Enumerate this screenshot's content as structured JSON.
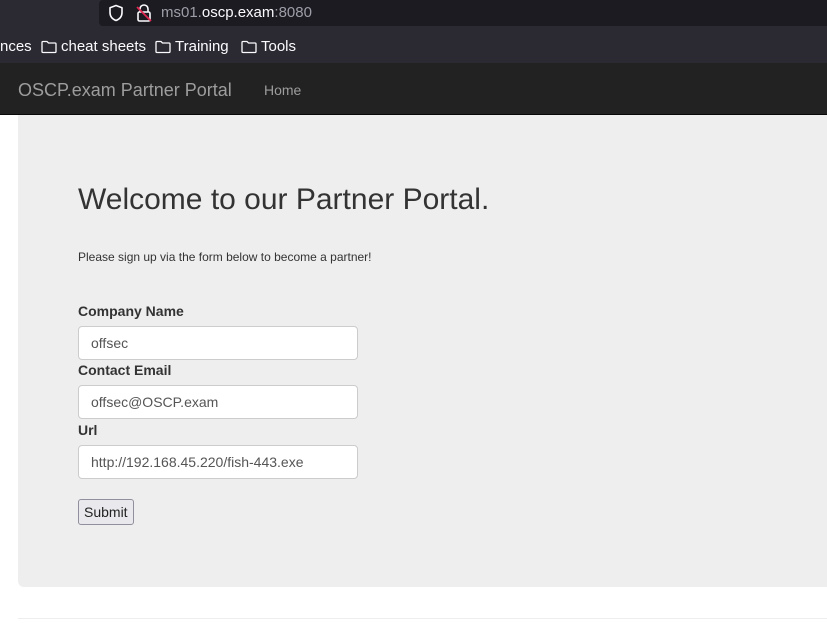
{
  "browser": {
    "url_prefix": "ms01.",
    "url_host": "oscp.exam",
    "url_port": ":8080",
    "bookmarks": [
      {
        "label": "nces"
      },
      {
        "label": "cheat sheets"
      },
      {
        "label": "Training"
      },
      {
        "label": "Tools"
      }
    ]
  },
  "navbar": {
    "brand": "OSCP.exam Partner Portal",
    "home": "Home"
  },
  "main": {
    "heading": "Welcome to our Partner Portal.",
    "intro": "Please sign up via the form below to become a partner!",
    "form": {
      "company_label": "Company Name",
      "company_value": "offsec",
      "email_label": "Contact Email",
      "email_value": "offsec@OSCP.exam",
      "url_label": "Url",
      "url_value": "http://192.168.45.220/fish-443.exe",
      "submit_label": "Submit"
    }
  },
  "icons": {
    "shield": "shield-icon",
    "lock": "lock-insecure-icon",
    "folder": "folder-icon"
  },
  "colors": {
    "chrome_bg": "#2b2a33",
    "urlbar_bg": "#1c1b22",
    "navbar_bg": "#222222",
    "jumbotron_bg": "#eeeeee",
    "insecure_red": "#e22850"
  }
}
